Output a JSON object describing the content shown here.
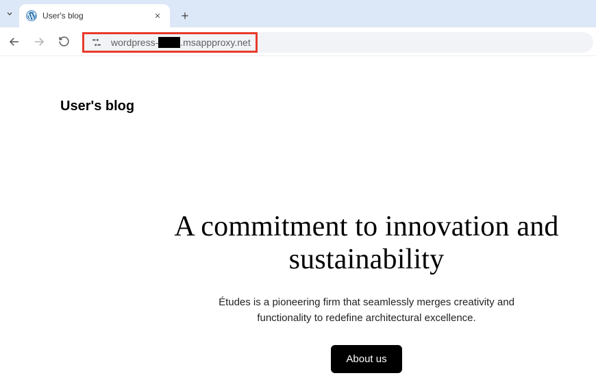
{
  "browser": {
    "tab": {
      "title": "User's blog",
      "favicon": "wordpress-icon"
    },
    "url_prefix": "wordpress-",
    "url_suffix": ".msappproxy.net"
  },
  "site": {
    "title": "User's blog"
  },
  "hero": {
    "heading_line1": "A commitment to innovation and",
    "heading_line2": "sustainability",
    "subtitle_line1": "Études is a pioneering firm that seamlessly merges creativity and",
    "subtitle_line2": "functionality to redefine architectural excellence.",
    "button_label": "About us"
  }
}
